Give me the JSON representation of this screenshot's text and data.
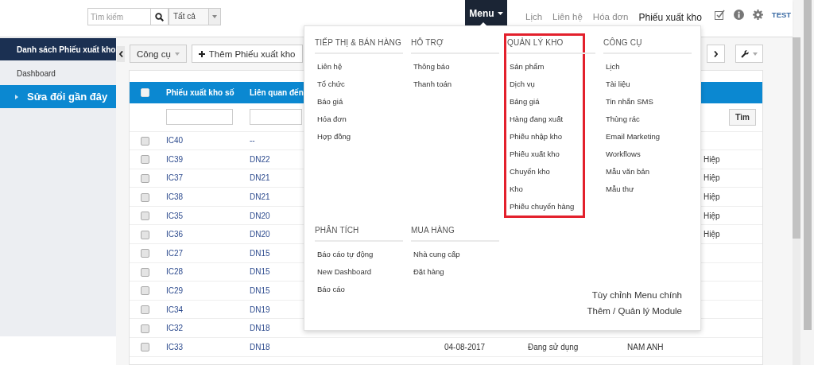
{
  "top_bar": {
    "search": {
      "placeholder": "Tìm kiếm"
    },
    "filter": {
      "value": "Tất cả"
    },
    "nav_links": [
      {
        "label": "Lịch",
        "selected": false
      },
      {
        "label": "Liên hệ",
        "selected": false
      },
      {
        "label": "Hóa đơn",
        "selected": false
      },
      {
        "label": "Phiếu xuất kho",
        "selected": true
      }
    ],
    "user": "TEST"
  },
  "sidebar": {
    "items": [
      {
        "label": "Danh sách Phiếu xuất kho",
        "kind": "title"
      },
      {
        "label": "Dashboard",
        "kind": "link"
      },
      {
        "label": "Sửa đổi gần đây",
        "kind": "section"
      }
    ]
  },
  "toolbar": {
    "buttons": [
      {
        "label": "Công cụ",
        "kind": "dropdown"
      },
      {
        "label": "Thêm Phiếu xuất kho",
        "kind": "add"
      }
    ]
  },
  "table": {
    "all_checked": false,
    "columns": [
      "Phiếu xuất kho số",
      "Liên quan đến"
    ],
    "search_button": "Tìm",
    "rows": [
      {
        "number": "IC40",
        "related": "--",
        "checked": false
      },
      {
        "number": "IC39",
        "related": "DN22",
        "column_6": "Hiệp",
        "checked": false
      },
      {
        "number": "IC37",
        "related": "DN21",
        "column_6": "Hiệp",
        "checked": false
      },
      {
        "number": "IC38",
        "related": "DN21",
        "column_6": "Hiệp",
        "checked": false
      },
      {
        "number": "IC35",
        "related": "DN20",
        "column_6": "Hiệp",
        "checked": false
      },
      {
        "number": "IC36",
        "related": "DN20",
        "column_6": "Hiệp",
        "checked": false
      },
      {
        "number": "IC27",
        "related": "DN15",
        "checked": false
      },
      {
        "number": "IC28",
        "related": "DN15",
        "checked": false
      },
      {
        "number": "IC29",
        "related": "DN15",
        "checked": false
      },
      {
        "number": "IC34",
        "related": "DN19",
        "checked": false
      },
      {
        "number": "IC32",
        "related": "DN18",
        "checked": false
      },
      {
        "number": "IC33",
        "related": "DN18",
        "date": "04-08-2017",
        "status": "Đang sử dụng",
        "person": "NAM ANH",
        "checked": false
      }
    ]
  },
  "menu": {
    "label": "Menu",
    "open": true,
    "sections": [
      {
        "title": "TIẾP THỊ & BÁN HÀNG",
        "highlighted": false,
        "items": [
          "Liên hệ",
          "Tổ chức",
          "Báo giá",
          "Hóa đơn",
          "Hợp đồng"
        ]
      },
      {
        "title": "HỖ TRỢ",
        "highlighted": false,
        "items": [
          "Thông báo",
          "Thanh toán"
        ]
      },
      {
        "title": "QUẢN LÝ KHO",
        "highlighted": true,
        "items": [
          "Sản phẩm",
          "Dịch vụ",
          "Bảng giá",
          "Hàng đang xuất",
          "Phiếu nhập kho",
          "Phiếu xuất kho",
          "Chuyển kho",
          "Kho",
          "Phiếu chuyển hàng"
        ]
      },
      {
        "title": "CÔNG CỤ",
        "highlighted": false,
        "items": [
          "Lịch",
          "Tài liệu",
          "Tin nhắn SMS",
          "Thùng rác",
          "Email Marketing",
          "Workflows",
          "Mẫu văn bản",
          "Mẫu thư"
        ]
      },
      {
        "title": "PHÂN TÍCH",
        "highlighted": false,
        "items": [
          "Báo cáo tự động",
          "New Dashboard",
          "Báo cáo"
        ]
      },
      {
        "title": "MUA HÀNG",
        "highlighted": false,
        "items": [
          "Nhà cung cấp",
          "Đặt hàng"
        ]
      }
    ],
    "footer_links": [
      "Tùy chỉnh Menu chính",
      "Thêm / Quản lý Module"
    ]
  }
}
